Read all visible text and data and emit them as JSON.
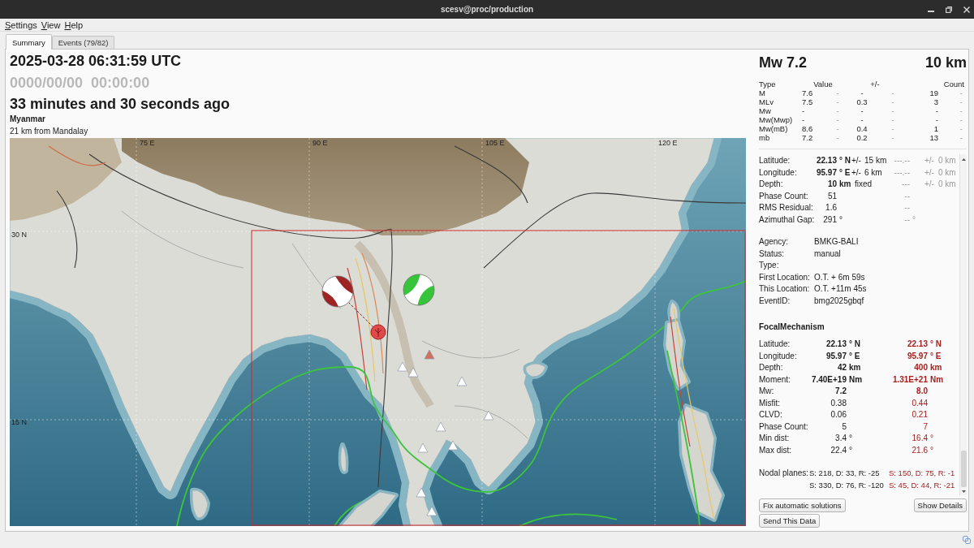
{
  "window": {
    "title": "scesv@proc/production"
  },
  "menu": [
    {
      "label": "Settings"
    },
    {
      "label": "View"
    },
    {
      "label": "Help"
    }
  ],
  "tabs": [
    {
      "label": "Summary",
      "selected": true
    },
    {
      "label": "Events (79/82)",
      "selected": false
    }
  ],
  "event": {
    "time": "2025-03-28 06:31:59 UTC",
    "reference_time": "0000/00/00  00:00:00",
    "age": "33 minutes and 30 seconds ago",
    "region": "Myanmar",
    "distance": "21 km from Mandalay"
  },
  "map": {
    "grid_labels": {
      "longitude": [
        "75 E",
        "90 E",
        "105 E",
        "120 E"
      ],
      "latitude": [
        "30 N",
        "15 N"
      ]
    },
    "focal_mechanisms": [
      {
        "color": "#9e2424"
      },
      {
        "color": "#35c43a"
      }
    ],
    "stations": [
      {
        "color": "#d0705e"
      },
      {
        "color": "#ffffff"
      },
      {
        "color": "#ffffff"
      },
      {
        "color": "#ffffff"
      },
      {
        "color": "#ffffff"
      },
      {
        "color": "#ffffff"
      },
      {
        "color": "#ffffff"
      },
      {
        "color": "#ffffff"
      },
      {
        "color": "#ffffff"
      },
      {
        "color": "#ffffff"
      }
    ]
  },
  "summary": {
    "magnitude": "Mw 7.2",
    "depth": "10 km"
  },
  "magnitudes": {
    "columns": [
      "Type",
      "Value",
      "+/-",
      "Count"
    ],
    "rows": [
      {
        "cells": [
          {
            "value": "M"
          },
          {
            "value": "7.6",
            "reference": "-"
          },
          {
            "value": "-",
            "reference": "-"
          },
          {
            "value": "19",
            "reference": "-"
          }
        ]
      },
      {
        "cells": [
          {
            "value": "MLv"
          },
          {
            "value": "7.5",
            "reference": "-"
          },
          {
            "value": "0.3",
            "reference": "-"
          },
          {
            "value": "3",
            "reference": "-"
          }
        ]
      },
      {
        "cells": [
          {
            "value": "Mw"
          },
          {
            "value": "-",
            "reference": "-"
          },
          {
            "value": "-",
            "reference": "-"
          },
          {
            "value": "-",
            "reference": "-"
          }
        ]
      },
      {
        "cells": [
          {
            "value": "Mw(Mwp)"
          },
          {
            "value": "-",
            "reference": "-"
          },
          {
            "value": "-",
            "reference": "-"
          },
          {
            "value": "-",
            "reference": "-"
          }
        ]
      },
      {
        "cells": [
          {
            "value": "Mw(mB)"
          },
          {
            "value": "8.6",
            "reference": "-"
          },
          {
            "value": "0.4",
            "reference": "-"
          },
          {
            "value": "1",
            "reference": "-"
          }
        ]
      },
      {
        "cells": [
          {
            "value": "mb"
          },
          {
            "value": "7.2",
            "reference": "-"
          },
          {
            "value": "0.2",
            "reference": "-"
          },
          {
            "value": "13",
            "reference": "-"
          }
        ]
      }
    ]
  },
  "origin": {
    "rows": [
      {
        "kind": "coordinate",
        "label": "Latitude:",
        "value": "22.13",
        "unit": "° N",
        "pm": "+/-",
        "error": "15 km",
        "ref_value": "---.--",
        "ref_pm": "+/-",
        "ref_error": "0 km"
      },
      {
        "kind": "coordinate",
        "label": "Longitude:",
        "value": "95.97",
        "unit": "° E",
        "pm": "+/-",
        "error": "6 km",
        "ref_value": "---.--",
        "ref_pm": "+/-",
        "ref_error": "0 km"
      },
      {
        "kind": "coordinate",
        "label": "Depth:",
        "value": "10",
        "unit": "km",
        "error": "fixed",
        "ref_value": "---",
        "ref_pm": "+/-",
        "ref_error": "0 km"
      },
      {
        "kind": "quality",
        "label": "Phase Count:",
        "value": "51",
        "ref_value": "--"
      },
      {
        "kind": "quality",
        "label": "RMS Residual:",
        "value": "1.6",
        "ref_value": "--"
      },
      {
        "kind": "quality",
        "label": "Azimuthal Gap:",
        "value": "291",
        "unit": "°",
        "ref_value": "--",
        "ref_unit": "°"
      }
    ],
    "info": [
      {
        "label": "Agency:",
        "value": "BMKG-BALI"
      },
      {
        "label": "Status:",
        "value": "manual"
      },
      {
        "label": "Type:"
      },
      {
        "label": "First Location:",
        "value": "O.T. + 6m 59s"
      },
      {
        "label": "This Location:",
        "value": "O.T. +11m 45s"
      },
      {
        "label": "EventID:",
        "value": "bmg2025gbqf"
      }
    ]
  },
  "focal_mechanism": {
    "title": "FocalMechanism",
    "rows": [
      {
        "kind": "main",
        "label": "Latitude:",
        "value": "22.13",
        "unit": "° N",
        "value_2": "22.13",
        "unit_2": "° N"
      },
      {
        "kind": "main",
        "label": "Longitude:",
        "value": "95.97",
        "unit": "° E",
        "value_2": "95.97",
        "unit_2": "° E"
      },
      {
        "kind": "main",
        "label": "Depth:",
        "value": "42",
        "unit": "km",
        "value_2": "400",
        "unit_2": "km"
      },
      {
        "kind": "main",
        "label": "Moment:",
        "value": "7.40E+19",
        "unit": "Nm",
        "value_2": "1.31E+21",
        "unit_2": "Nm"
      },
      {
        "kind": "main",
        "label": "Mw:",
        "value": "7.2",
        "value_2": "8.0"
      },
      {
        "kind": "detail",
        "label": "Misfit:",
        "value": "0.38",
        "value_2": "0.44"
      },
      {
        "kind": "detail",
        "label": "CLVD:",
        "value": "0.06",
        "value_2": "0.21"
      },
      {
        "kind": "detail",
        "label": "Phase Count:",
        "value": "5",
        "value_2": "7"
      },
      {
        "kind": "detail",
        "label": "Min dist:",
        "value": "3.4",
        "unit": "°",
        "value_2": "16.4",
        "unit_2": "°"
      },
      {
        "kind": "detail",
        "label": "Max dist:",
        "value": "22.4",
        "unit": "°",
        "value_2": "21.6",
        "unit_2": "°"
      }
    ],
    "nodal_planes": {
      "label": "Nodal planes:",
      "planes": [
        {
          "value": "S: 218, D: 33, R: -25",
          "value_2": "S: 150, D: 75, R: -1"
        },
        {
          "value": "S: 330, D: 76, R: -120",
          "value_2": "S: 45, D: 44, R: -21"
        }
      ]
    }
  },
  "buttons": [
    {
      "label": "Fix automatic solutions"
    },
    {
      "label": "Show Details"
    },
    {
      "label": "Send This Data"
    }
  ]
}
